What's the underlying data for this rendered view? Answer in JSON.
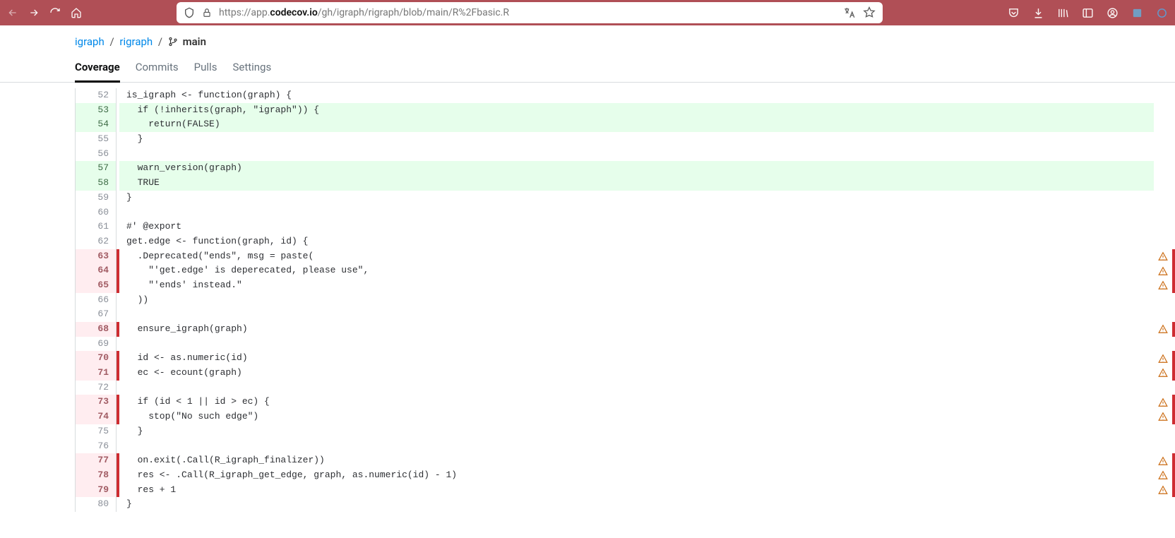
{
  "url": {
    "prefix": "https://app.",
    "bold": "codecov.io",
    "suffix": "/gh/igraph/rigraph/blob/main/R%2Fbasic.R"
  },
  "crumbs": {
    "owner": "igraph",
    "repo": "rigraph",
    "branch": "main"
  },
  "tabs": {
    "coverage": "Coverage",
    "commits": "Commits",
    "pulls": "Pulls",
    "settings": "Settings"
  },
  "lines": [
    {
      "n": 52,
      "status": "none",
      "text": "is_igraph <- function(graph) {"
    },
    {
      "n": 53,
      "status": "green",
      "text": "  if (!inherits(graph, \"igraph\")) {"
    },
    {
      "n": 54,
      "status": "green",
      "text": "    return(FALSE)"
    },
    {
      "n": 55,
      "status": "none",
      "text": "  }"
    },
    {
      "n": 56,
      "status": "none",
      "text": ""
    },
    {
      "n": 57,
      "status": "green",
      "text": "  warn_version(graph)"
    },
    {
      "n": 58,
      "status": "green",
      "text": "  TRUE"
    },
    {
      "n": 59,
      "status": "none",
      "text": "}"
    },
    {
      "n": 60,
      "status": "none",
      "text": ""
    },
    {
      "n": 61,
      "status": "none",
      "text": "#' @export"
    },
    {
      "n": 62,
      "status": "none",
      "text": "get.edge <- function(graph, id) {"
    },
    {
      "n": 63,
      "status": "red",
      "text": "  .Deprecated(\"ends\", msg = paste(",
      "warn": true
    },
    {
      "n": 64,
      "status": "red",
      "text": "    \"'get.edge' is deperecated, please use\",",
      "warn": true
    },
    {
      "n": 65,
      "status": "red",
      "text": "    \"'ends' instead.\"",
      "warn": true
    },
    {
      "n": 66,
      "status": "none",
      "text": "  ))"
    },
    {
      "n": 67,
      "status": "none",
      "text": ""
    },
    {
      "n": 68,
      "status": "red",
      "text": "  ensure_igraph(graph)",
      "warn": true
    },
    {
      "n": 69,
      "status": "none",
      "text": ""
    },
    {
      "n": 70,
      "status": "red",
      "text": "  id <- as.numeric(id)",
      "warn": true
    },
    {
      "n": 71,
      "status": "red",
      "text": "  ec <- ecount(graph)",
      "warn": true
    },
    {
      "n": 72,
      "status": "none",
      "text": ""
    },
    {
      "n": 73,
      "status": "red",
      "text": "  if (id < 1 || id > ec) {",
      "warn": true
    },
    {
      "n": 74,
      "status": "red",
      "text": "    stop(\"No such edge\")",
      "warn": true
    },
    {
      "n": 75,
      "status": "none",
      "text": "  }"
    },
    {
      "n": 76,
      "status": "none",
      "text": ""
    },
    {
      "n": 77,
      "status": "red",
      "text": "  on.exit(.Call(R_igraph_finalizer))",
      "warn": true
    },
    {
      "n": 78,
      "status": "red",
      "text": "  res <- .Call(R_igraph_get_edge, graph, as.numeric(id) - 1)",
      "warn": true
    },
    {
      "n": 79,
      "status": "red",
      "text": "  res + 1",
      "warn": true
    },
    {
      "n": 80,
      "status": "none",
      "text": "}"
    }
  ]
}
